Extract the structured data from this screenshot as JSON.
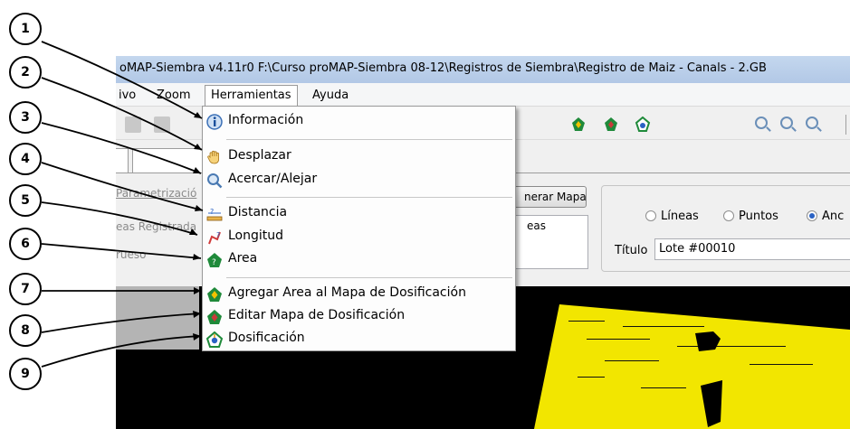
{
  "window": {
    "title": "oMAP-Siembra v4.11r0    F:\\Curso proMAP-Siembra 08-12\\Registros de Siembra\\Registro de Maiz - Canals - 2.GB"
  },
  "menubar": {
    "archivo": "ivo",
    "zoom": "Zoom",
    "herramientas": "Herramientas",
    "ayuda": "Ayuda"
  },
  "panel": {
    "param_label": "Parametrizació",
    "lineas_reg_label": "eas Registrada",
    "grueso_label": "rueso",
    "generar_button": "nerar Mapa",
    "listbox_text": "eas",
    "radio_lineas": "Líneas",
    "radio_puntos": "Puntos",
    "radio_ancho": "Anc",
    "radio_selected": "Anc",
    "titulo_label": "Título",
    "titulo_value": "Lote #00010"
  },
  "dropdown": {
    "items": [
      {
        "label": "Información",
        "icon": "info-icon"
      },
      {
        "label": "Desplazar",
        "icon": "hand-icon"
      },
      {
        "label": "Acercar/Alejar",
        "icon": "magnifier-icon"
      },
      {
        "label": "Distancia",
        "icon": "ruler-icon"
      },
      {
        "label": "Longitud",
        "icon": "longitude-icon"
      },
      {
        "label": "Area",
        "icon": "area-icon"
      },
      {
        "label": "Agregar Area al Mapa de Dosificación",
        "icon": "add-area-icon"
      },
      {
        "label": "Editar Mapa de Dosificación",
        "icon": "edit-map-icon"
      },
      {
        "label": "Dosificación",
        "icon": "dosing-icon"
      }
    ]
  },
  "callouts": [
    "1",
    "2",
    "3",
    "4",
    "5",
    "6",
    "7",
    "8",
    "9"
  ],
  "colors": {
    "map_background": "#000000",
    "field_yellow": "#f2e600",
    "accent_green": "#1f8a3a",
    "title_bar": "#bcd0ea"
  }
}
